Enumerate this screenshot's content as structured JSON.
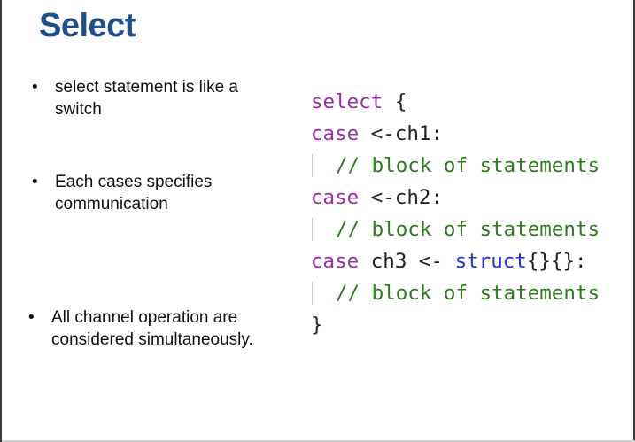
{
  "title": "Select",
  "bullets": [
    {
      "symbol": "•",
      "text": "select statement is like a switch"
    },
    {
      "symbol": "•",
      "text": "Each cases specifies communication"
    },
    {
      "symbol": "•",
      "text": "All channel operation are considered simultaneously."
    }
  ],
  "code": {
    "l1_kw": "select",
    "l1_rest": " {",
    "l2_kw": "case",
    "l2_rest": " <-ch1:",
    "l3_comment": "// block of statements",
    "l4_kw": "case",
    "l4_rest": " <-ch2:",
    "l5_comment": "// block of statements",
    "l6_kw": "case",
    "l6_mid": " ch3 <- ",
    "l6_type": "struct",
    "l6_rest": "{}{}:",
    "l7_comment": "// block of statements",
    "l8": "}"
  },
  "colors": {
    "title": "#1f4e8a",
    "keyword": "#9b2ea8",
    "type": "#2237c9",
    "comment": "#2f7a1f"
  }
}
